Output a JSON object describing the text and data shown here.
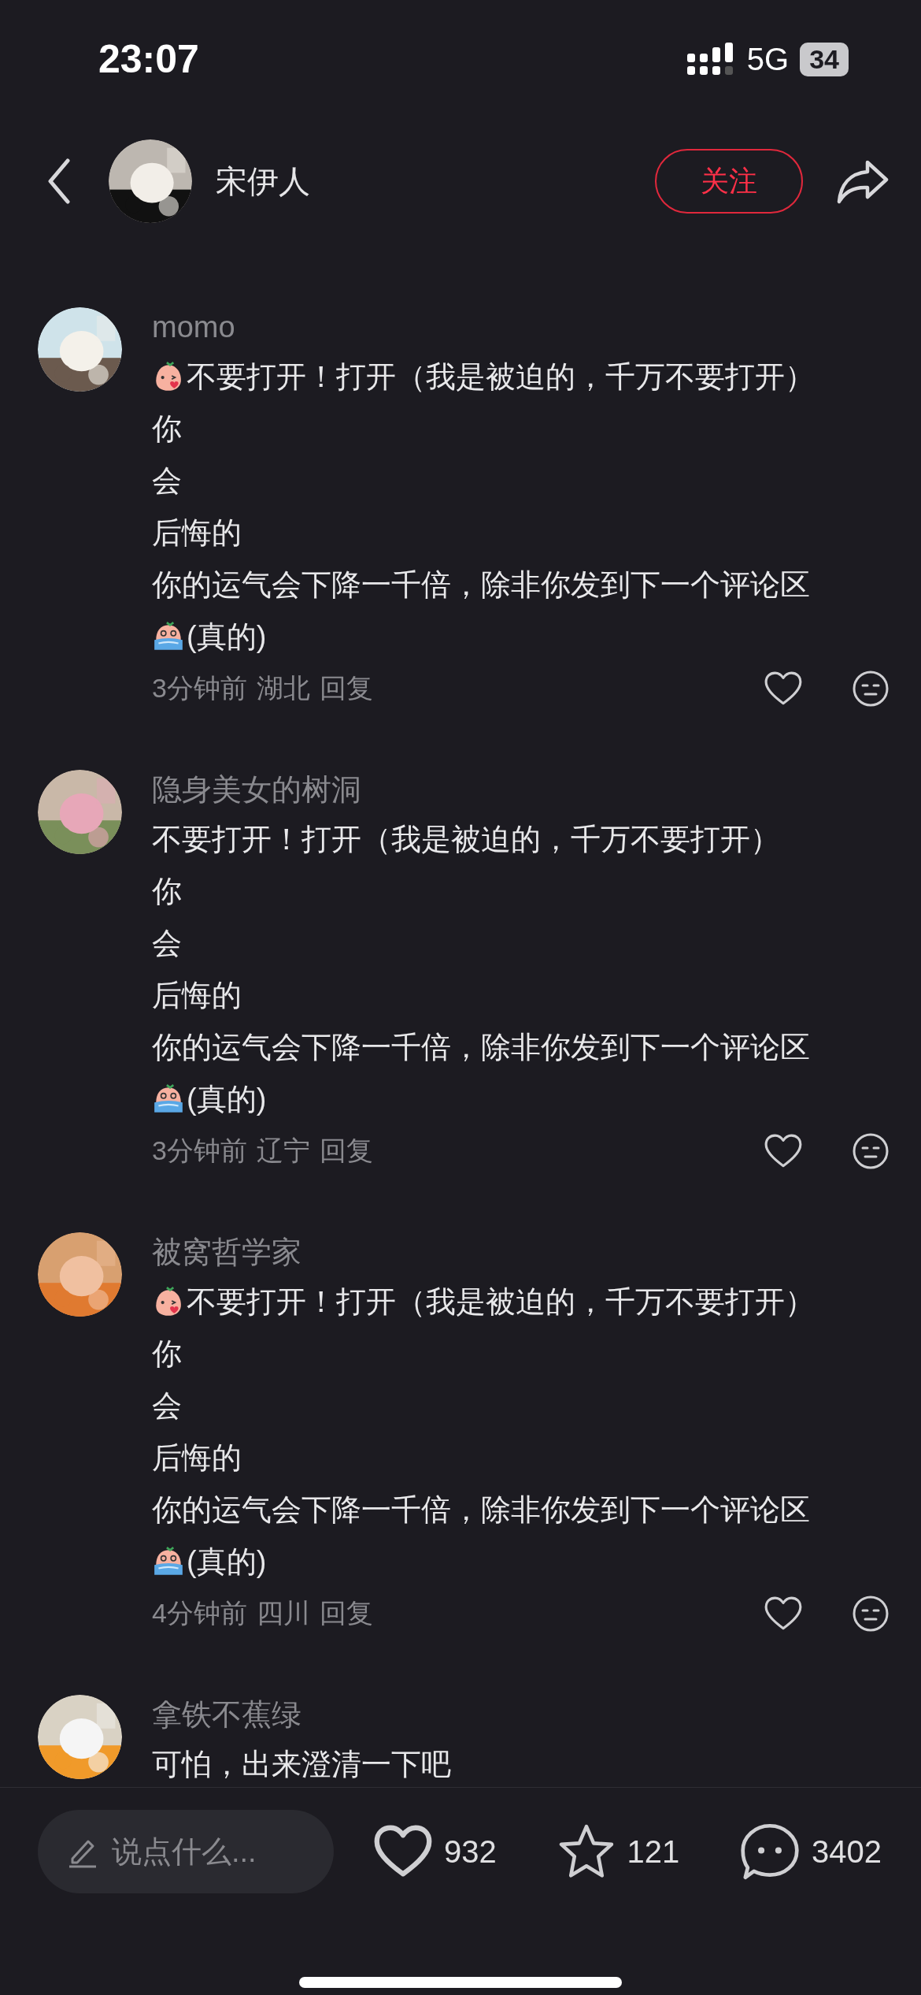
{
  "status_bar": {
    "time": "23:07",
    "network": "5G",
    "battery": "34"
  },
  "header": {
    "name": "宋伊人",
    "follow_button": "关注"
  },
  "comments": [
    {
      "name": "momo",
      "lines": [
        {
          "kind": "kiss",
          "text": "不要打开！打开（我是被迫的，千万不要打开）"
        },
        {
          "kind": "plain",
          "text": "你"
        },
        {
          "kind": "plain",
          "text": "会"
        },
        {
          "kind": "plain",
          "text": "后悔的"
        },
        {
          "kind": "plain",
          "text": "你的运气会下降一千倍，除非你发到下一个评论区"
        },
        {
          "kind": "cry",
          "text": "(真的)"
        }
      ],
      "time": "3分钟前",
      "location": "湖北",
      "reply": "回复"
    },
    {
      "name": "隐身美女的树洞",
      "lines": [
        {
          "kind": "plain",
          "text": "不要打开！打开（我是被迫的，千万不要打开）"
        },
        {
          "kind": "plain",
          "text": "你"
        },
        {
          "kind": "plain",
          "text": "会"
        },
        {
          "kind": "plain",
          "text": "后悔的"
        },
        {
          "kind": "plain",
          "text": "你的运气会下降一千倍，除非你发到下一个评论区"
        },
        {
          "kind": "cry",
          "text": "(真的)"
        }
      ],
      "time": "3分钟前",
      "location": "辽宁",
      "reply": "回复"
    },
    {
      "name": "被窝哲学家",
      "lines": [
        {
          "kind": "kiss",
          "text": "不要打开！打开（我是被迫的，千万不要打开）"
        },
        {
          "kind": "plain",
          "text": "你"
        },
        {
          "kind": "plain",
          "text": "会"
        },
        {
          "kind": "plain",
          "text": "后悔的"
        },
        {
          "kind": "plain",
          "text": "你的运气会下降一千倍，除非你发到下一个评论区"
        },
        {
          "kind": "cry",
          "text": "(真的)"
        }
      ],
      "time": "4分钟前",
      "location": "四川",
      "reply": "回复"
    },
    {
      "name": "拿铁不蕉绿",
      "lines": [
        {
          "kind": "plain",
          "text": "可怕，出来澄清一下吧"
        }
      ]
    }
  ],
  "bottom_bar": {
    "input": {
      "placeholder": "说点什么..."
    },
    "likes": "932",
    "favorites": "121",
    "comments": "3402"
  }
}
